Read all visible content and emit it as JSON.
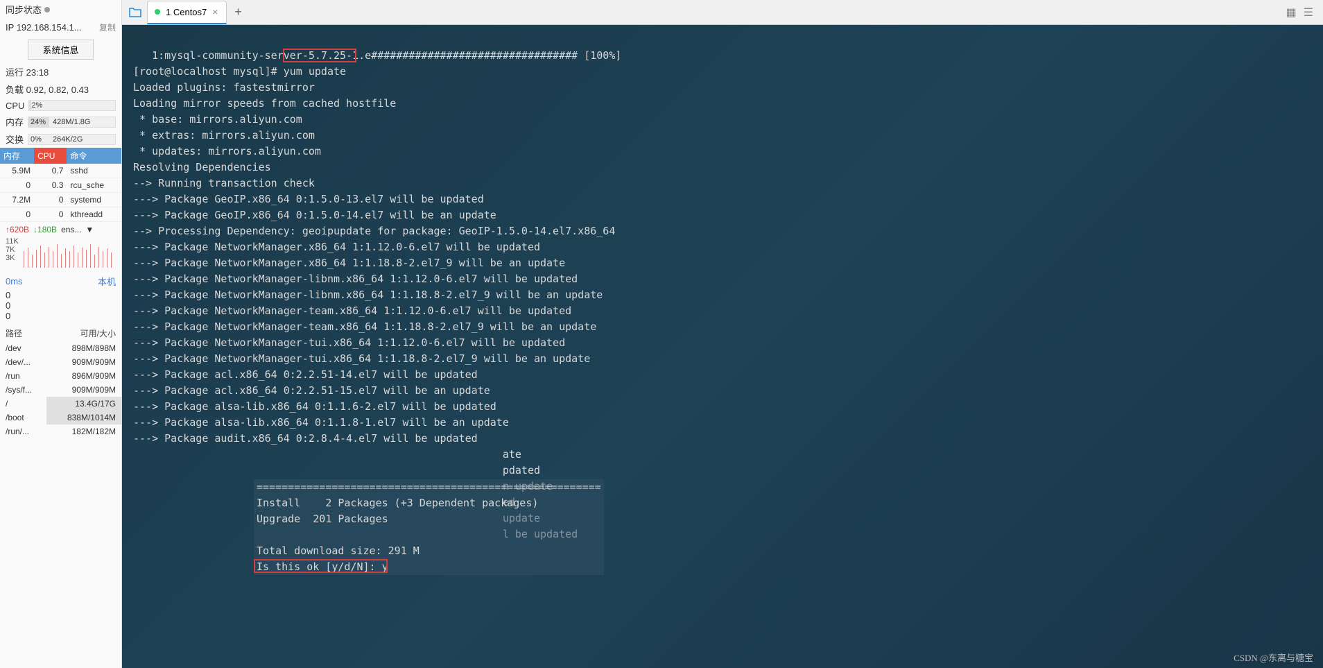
{
  "sidebar": {
    "sync_label": "同步状态",
    "ip_label": "IP",
    "ip_value": "192.168.154.1...",
    "copy_label": "复制",
    "sysinfo_btn": "系统信息",
    "uptime_label": "运行",
    "uptime_value": "23:18",
    "load_label": "负载",
    "load_value": "0.92, 0.82, 0.43",
    "cpu_label": "CPU",
    "cpu_pct": "2%",
    "mem_label": "内存",
    "mem_pct": "24%",
    "mem_value": "428M/1.8G",
    "swap_label": "交换",
    "swap_pct": "0%",
    "swap_value": "264K/2G",
    "proc_headers": {
      "mem": "内存",
      "cpu": "CPU",
      "cmd": "命令"
    },
    "procs": [
      {
        "mem": "5.9M",
        "cpu": "0.7",
        "cmd": "sshd"
      },
      {
        "mem": "0",
        "cpu": "0.3",
        "cmd": "rcu_sche"
      },
      {
        "mem": "7.2M",
        "cpu": "0",
        "cmd": "systemd"
      },
      {
        "mem": "0",
        "cpu": "0",
        "cmd": "kthreadd"
      }
    ],
    "net": {
      "up": "620B",
      "down": "180B",
      "iface": "ens...",
      "drop": "▼"
    },
    "chart_labels": [
      "11K",
      "7K",
      "3K"
    ],
    "ping_label": "0ms",
    "host_label": "本机",
    "zeros": [
      "0",
      "0",
      "0"
    ],
    "fs_headers": {
      "path": "路径",
      "size": "可用/大小"
    },
    "fs": [
      {
        "p": "/dev",
        "s": "898M/898M",
        "hl": false
      },
      {
        "p": "/dev/...",
        "s": "909M/909M",
        "hl": false
      },
      {
        "p": "/run",
        "s": "896M/909M",
        "hl": false
      },
      {
        "p": "/sys/f...",
        "s": "909M/909M",
        "hl": false
      },
      {
        "p": "/",
        "s": "13.4G/17G",
        "hl": true
      },
      {
        "p": "/boot",
        "s": "838M/1014M",
        "hl": true
      },
      {
        "p": "/run/...",
        "s": "182M/182M",
        "hl": false
      }
    ]
  },
  "tabs": {
    "active_label": "1 Centos7"
  },
  "terminal": {
    "lines": [
      "   1:mysql-community-server-5.7.25-1.e################################# [100%]",
      "[root@localhost mysql]# yum update",
      "Loaded plugins: fastestmirror",
      "Loading mirror speeds from cached hostfile",
      " * base: mirrors.aliyun.com",
      " * extras: mirrors.aliyun.com",
      " * updates: mirrors.aliyun.com",
      "Resolving Dependencies",
      "--> Running transaction check",
      "---> Package GeoIP.x86_64 0:1.5.0-13.el7 will be updated",
      "---> Package GeoIP.x86_64 0:1.5.0-14.el7 will be an update",
      "--> Processing Dependency: geoipupdate for package: GeoIP-1.5.0-14.el7.x86_64",
      "---> Package NetworkManager.x86_64 1:1.12.0-6.el7 will be updated",
      "---> Package NetworkManager.x86_64 1:1.18.8-2.el7_9 will be an update",
      "---> Package NetworkManager-libnm.x86_64 1:1.12.0-6.el7 will be updated",
      "---> Package NetworkManager-libnm.x86_64 1:1.18.8-2.el7_9 will be an update",
      "---> Package NetworkManager-team.x86_64 1:1.12.0-6.el7 will be updated",
      "---> Package NetworkManager-team.x86_64 1:1.18.8-2.el7_9 will be an update",
      "---> Package NetworkManager-tui.x86_64 1:1.12.0-6.el7 will be updated",
      "---> Package NetworkManager-tui.x86_64 1:1.18.8-2.el7_9 will be an update",
      "---> Package acl.x86_64 0:2.2.51-14.el7 will be updated",
      "---> Package acl.x86_64 0:2.2.51-15.el7 will be an update",
      "---> Package alsa-lib.x86_64 0:1.1.6-2.el7 will be updated",
      "---> Package alsa-lib.x86_64 0:1.1.8-1.el7 will be an update",
      "---> Package audit.x86_64 0:2.8.4-4.el7 will be updated",
      "                                                           ate",
      "                                                           pdated",
      "                                                           n update",
      "                                                           ed",
      "                                                           update",
      "                                                           l be updated"
    ],
    "float_lines": [
      "=======================================================",
      "Install    2 Packages (+3 Dependent packages)",
      "Upgrade  201 Packages",
      "",
      "Total download size: 291 M",
      "Is this ok [y/d/N]: y"
    ]
  },
  "watermark": "CSDN @东离与糖宝"
}
